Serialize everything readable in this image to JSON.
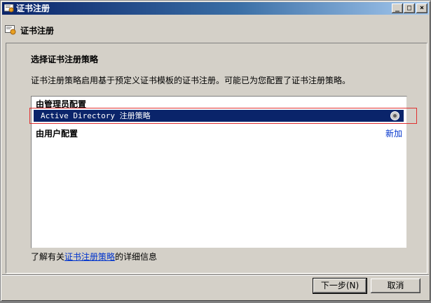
{
  "window": {
    "title": "证书注册",
    "controls": {
      "minimize": "_",
      "maximize": "□",
      "close": "×"
    }
  },
  "header": {
    "title": "证书注册",
    "icon": "certificate-icon"
  },
  "main": {
    "section_title": "选择证书注册策略",
    "description": "证书注册策略启用基于预定义证书模板的证书注册。可能已为您配置了证书注册策略。",
    "list": {
      "admin_group": "由管理员配置",
      "selected_policy": "Active Directory 注册策略",
      "user_group": "由用户配置",
      "add_label": "新加"
    },
    "learn_more": {
      "prefix": "了解有关",
      "link": "证书注册策略",
      "suffix": "的详细信息"
    }
  },
  "buttons": {
    "next": "下一步(N)",
    "cancel": "取消"
  },
  "colors": {
    "selection": "#0a246a",
    "highlight_box": "#e03030",
    "link": "#0033cc"
  }
}
